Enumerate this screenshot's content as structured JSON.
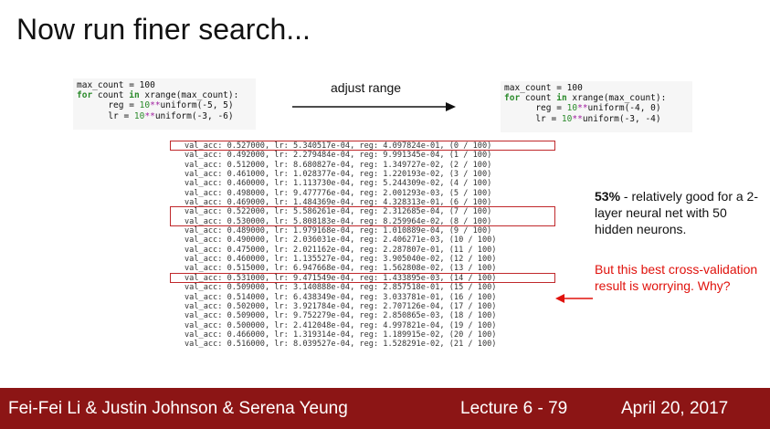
{
  "slide": {
    "title": "Now run finer search..."
  },
  "code_left": {
    "line1": "max_count = 100",
    "line2_kw1": "for",
    "line2_mid": " count ",
    "line2_kw2": "in",
    "line2_rest": " xrange(max_count):",
    "line3_a": "      reg = ",
    "line3_num": "10",
    "line3_op": "**",
    "line3_rest": "uniform(-5, 5)",
    "line4_a": "      lr = ",
    "line4_num": "10",
    "line4_op": "**",
    "line4_rest": "uniform(-3, -6)"
  },
  "code_right": {
    "line1": "max_count = 100",
    "line2_kw1": "for",
    "line2_mid": " count ",
    "line2_kw2": "in",
    "line2_rest": " xrange(max_count):",
    "line3_a": "      reg = ",
    "line3_num": "10",
    "line3_op": "**",
    "line3_rest": "uniform(-4, 0)",
    "line4_a": "      lr = ",
    "line4_num": "10",
    "line4_op": "**",
    "line4_rest": "uniform(-3, -4)"
  },
  "adjust_label": "adjust range",
  "results": [
    "val_acc: 0.527000, lr: 5.340517e-04, reg: 4.097824e-01, (0 / 100)",
    "val_acc: 0.492000, lr: 2.279484e-04, reg: 9.991345e-04, (1 / 100)",
    "val_acc: 0.512000, lr: 8.680827e-04, reg: 1.349727e-02, (2 / 100)",
    "val_acc: 0.461000, lr: 1.028377e-04, reg: 1.220193e-02, (3 / 100)",
    "val_acc: 0.460000, lr: 1.113730e-04, reg: 5.244309e-02, (4 / 100)",
    "val_acc: 0.498000, lr: 9.477776e-04, reg: 2.001293e-03, (5 / 100)",
    "val_acc: 0.469000, lr: 1.484369e-04, reg: 4.328313e-01, (6 / 100)",
    "val_acc: 0.522000, lr: 5.586261e-04, reg: 2.312685e-04, (7 / 100)",
    "val_acc: 0.530000, lr: 5.808183e-04, reg: 8.259964e-02, (8 / 100)",
    "val_acc: 0.489000, lr: 1.979168e-04, reg: 1.010889e-04, (9 / 100)",
    "val_acc: 0.490000, lr: 2.036031e-04, reg: 2.406271e-03, (10 / 100)",
    "val_acc: 0.475000, lr: 2.021162e-04, reg: 2.287807e-01, (11 / 100)",
    "val_acc: 0.460000, lr: 1.135527e-04, reg: 3.905040e-02, (12 / 100)",
    "val_acc: 0.515000, lr: 6.947668e-04, reg: 1.562808e-02, (13 / 100)",
    "val_acc: 0.531000, lr: 9.471549e-04, reg: 1.433895e-03, (14 / 100)",
    "val_acc: 0.509000, lr: 3.140888e-04, reg: 2.857518e-01, (15 / 100)",
    "val_acc: 0.514000, lr: 6.438349e-04, reg: 3.033781e-01, (16 / 100)",
    "val_acc: 0.502000, lr: 3.921784e-04, reg: 2.707126e-04, (17 / 100)",
    "val_acc: 0.509000, lr: 9.752279e-04, reg: 2.850865e-03, (18 / 100)",
    "val_acc: 0.500000, lr: 2.412048e-04, reg: 4.997821e-04, (19 / 100)",
    "val_acc: 0.466000, lr: 1.319314e-04, reg: 1.189915e-02, (20 / 100)",
    "val_acc: 0.516000, lr: 8.039527e-04, reg: 1.528291e-02, (21 / 100)"
  ],
  "highlight_rows": [
    0,
    7,
    8,
    14
  ],
  "note": {
    "bold": "53%",
    "rest": " - relatively good for a 2-layer neural net with 50 hidden neurons."
  },
  "warning": "But this best cross-validation result is worrying. Why?",
  "colors": {
    "accent_red": "#c0282b",
    "warning_red": "#e0120c",
    "footer_bg": "#8c1515"
  },
  "footer": {
    "authors": "Fei-Fei Li & Justin Johnson & Serena Yeung",
    "lecture": "Lecture 6 - 79",
    "date": "April 20, 2017"
  }
}
